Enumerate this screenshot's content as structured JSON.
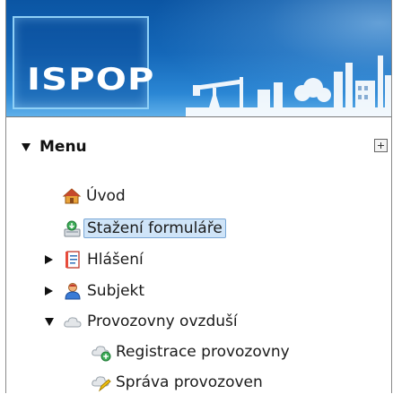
{
  "banner": {
    "logo_text": "ISPOP"
  },
  "menu": {
    "title": "Menu",
    "expand_all_icon": "expand-all-icon",
    "items": [
      {
        "label": "Úvod",
        "icon": "home-icon",
        "level": 1,
        "selected": false
      },
      {
        "label": "Stažení formuláře",
        "icon": "download-form-icon",
        "level": 1,
        "selected": true
      },
      {
        "label": "Hlášení",
        "icon": "report-icon",
        "level": 1,
        "expander": "collapsed"
      },
      {
        "label": "Subjekt",
        "icon": "user-icon",
        "level": 1,
        "expander": "collapsed"
      },
      {
        "label": "Provozovny ovzduší",
        "icon": "cloud-icon",
        "level": 1,
        "expander": "expanded"
      },
      {
        "label": "Registrace provozovny",
        "icon": "cloud-add-icon",
        "level": 2
      },
      {
        "label": "Správa provozoven",
        "icon": "cloud-edit-icon",
        "level": 2
      }
    ]
  }
}
